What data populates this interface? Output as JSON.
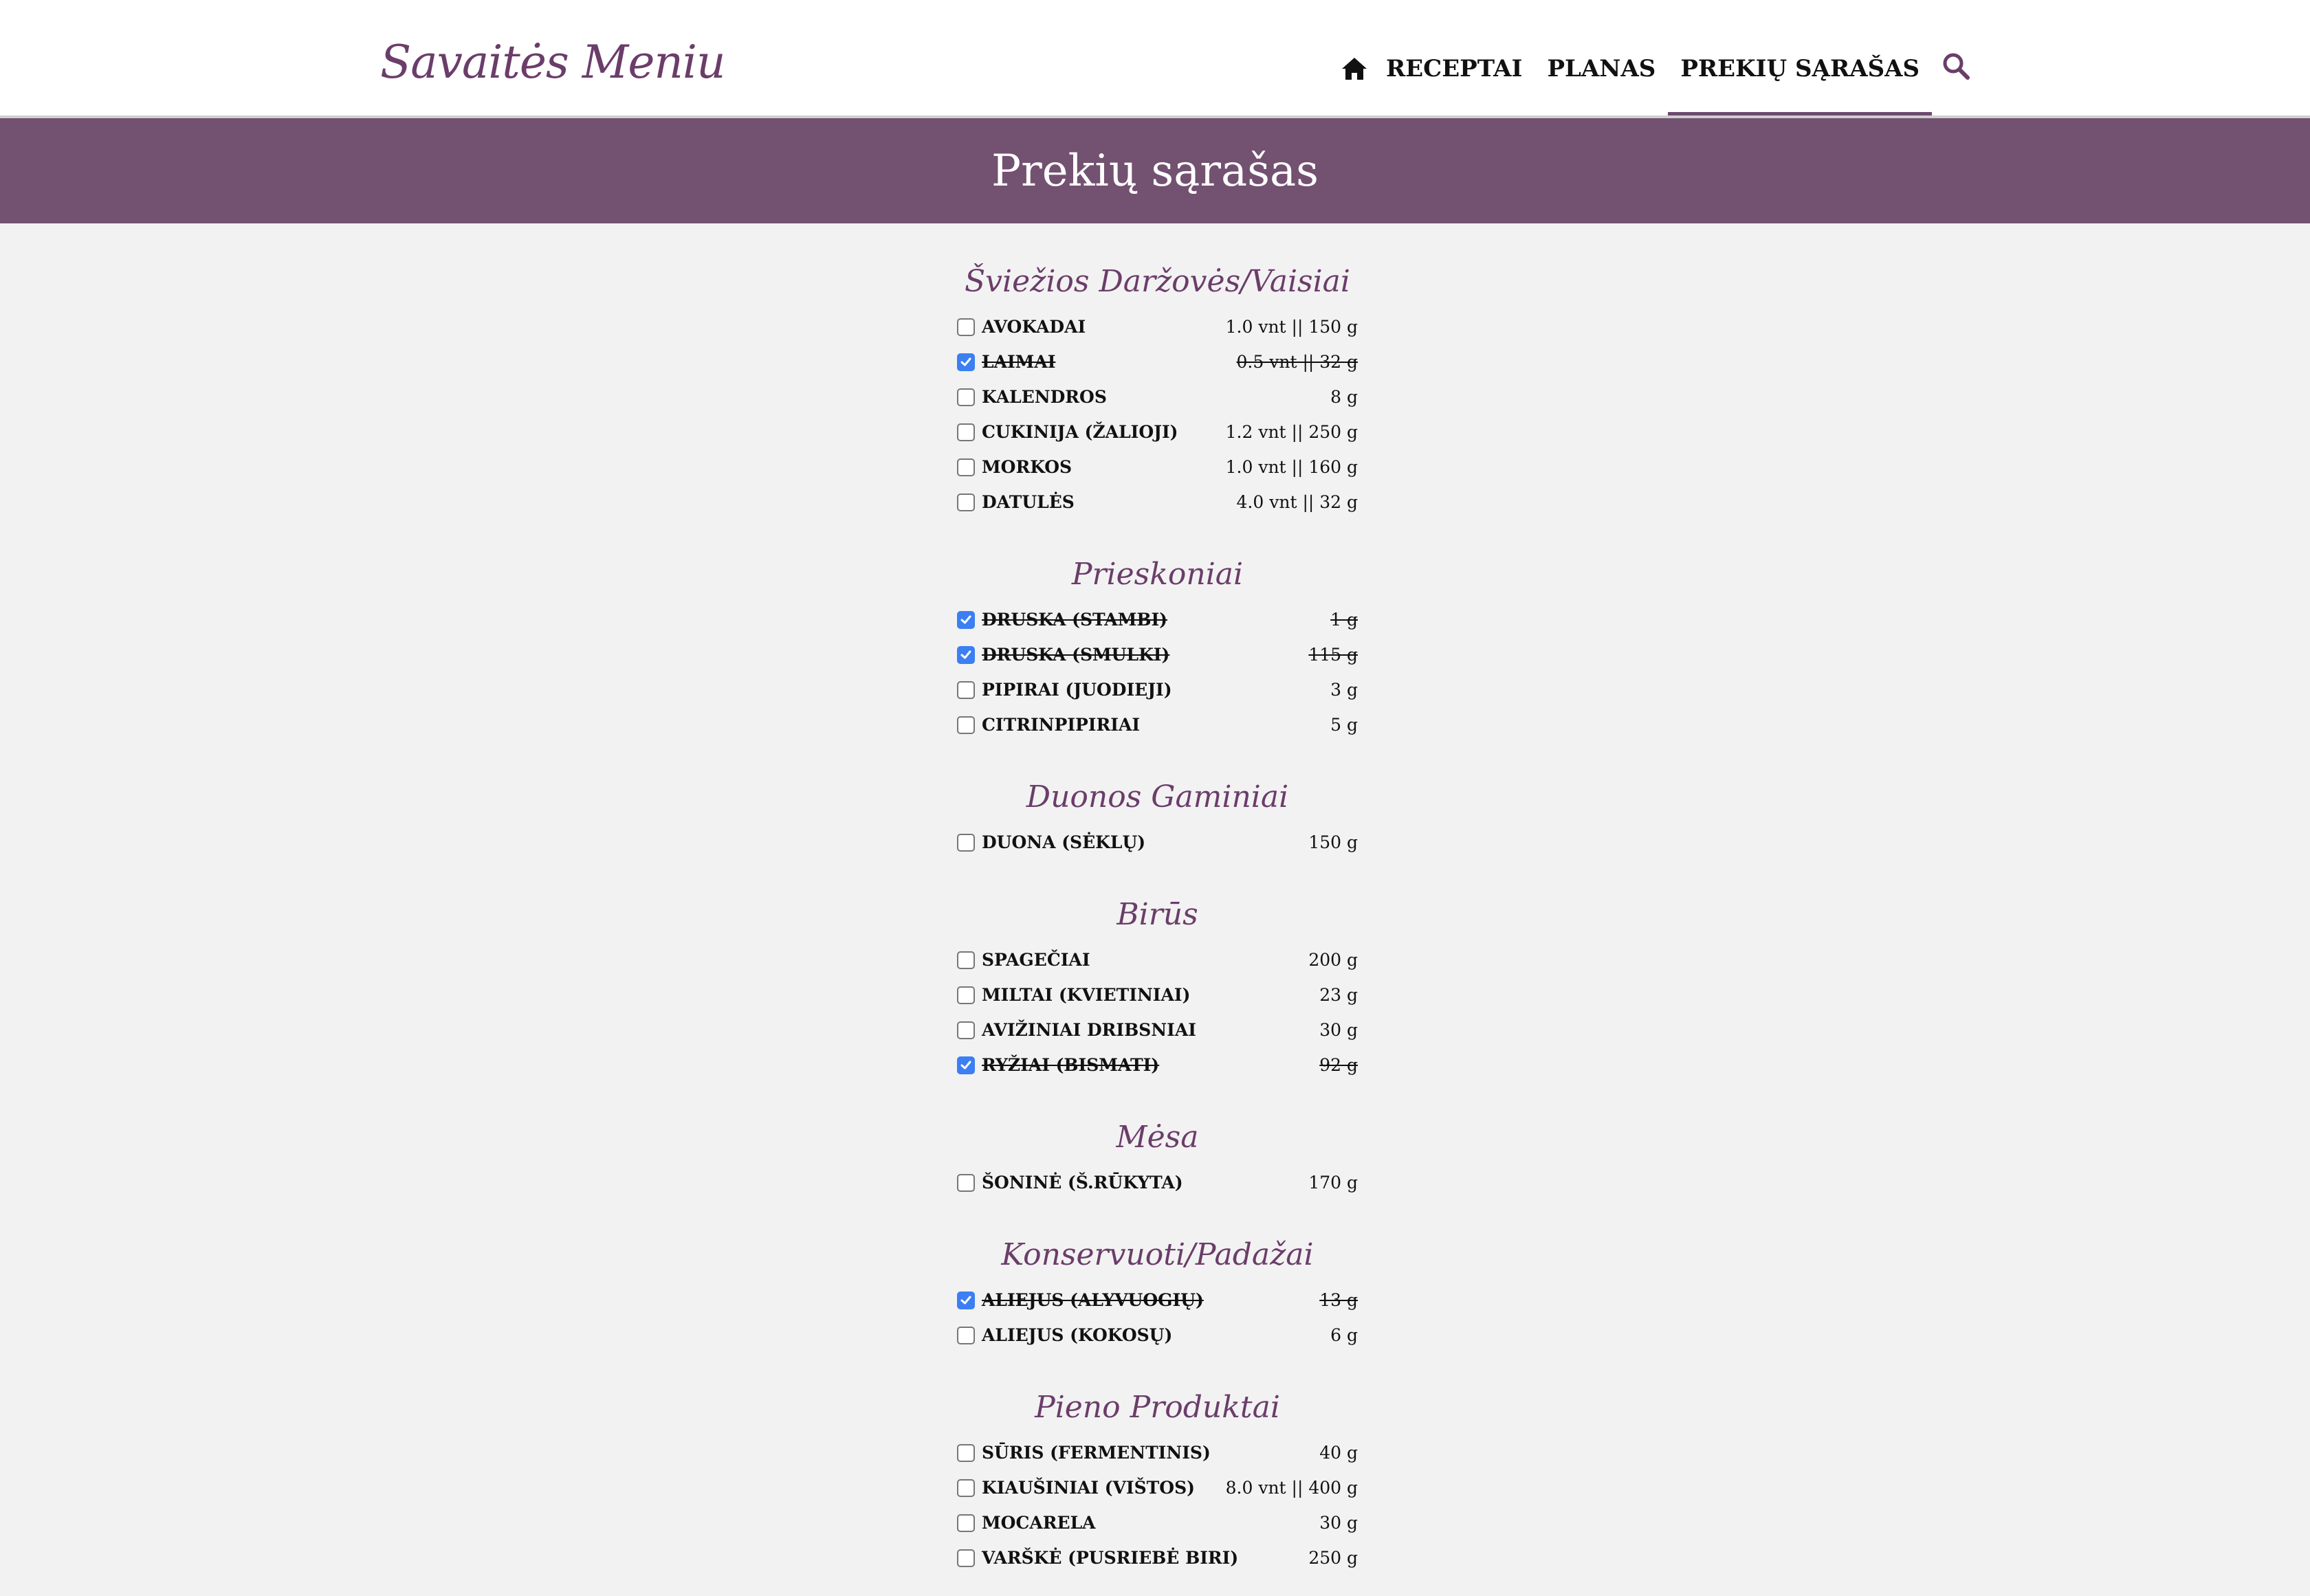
{
  "header": {
    "logo": "Savaitės Meniu",
    "nav": [
      {
        "label": "RECEPTAI",
        "active": false
      },
      {
        "label": "PLANAS",
        "active": false
      },
      {
        "label": "PREKIŲ SĄRAŠAS",
        "active": true
      }
    ],
    "icons": [
      "home-icon",
      "search-icon"
    ]
  },
  "page_title": "Prekių sąrašas",
  "colors": {
    "accent": "#735170",
    "heading": "#6b3d6a",
    "checkbox": "#3b7ff2"
  },
  "sections": [
    {
      "title": "Šviežios Daržovės/Vaisiai",
      "items": [
        {
          "name": "AVOKADAI",
          "qty": "1.0 vnt || 150 g",
          "checked": false
        },
        {
          "name": "LAIMAI",
          "qty": "0.5 vnt || 32 g",
          "checked": true
        },
        {
          "name": "KALENDROS",
          "qty": "8 g",
          "checked": false
        },
        {
          "name": "CUKINIJA (ŽALIOJI)",
          "qty": "1.2 vnt || 250 g",
          "checked": false
        },
        {
          "name": "MORKOS",
          "qty": "1.0 vnt || 160 g",
          "checked": false
        },
        {
          "name": "DATULĖS",
          "qty": "4.0 vnt || 32 g",
          "checked": false
        }
      ]
    },
    {
      "title": "Prieskoniai",
      "items": [
        {
          "name": "DRUSKA (STAMBI)",
          "qty": "1 g",
          "checked": true
        },
        {
          "name": "DRUSKA (SMULKI)",
          "qty": "115 g",
          "checked": true
        },
        {
          "name": "PIPIRAI (JUODIEJI)",
          "qty": "3 g",
          "checked": false
        },
        {
          "name": "CITRINPIPIRIAI",
          "qty": "5 g",
          "checked": false
        }
      ]
    },
    {
      "title": "Duonos Gaminiai",
      "items": [
        {
          "name": "DUONA (SĖKLŲ)",
          "qty": "150 g",
          "checked": false
        }
      ]
    },
    {
      "title": "Birūs",
      "items": [
        {
          "name": "SPAGEČIAI",
          "qty": "200 g",
          "checked": false
        },
        {
          "name": "MILTAI (KVIETINIAI)",
          "qty": "23 g",
          "checked": false
        },
        {
          "name": "AVIŽINIAI DRIBSNIAI",
          "qty": "30 g",
          "checked": false
        },
        {
          "name": "RYŽIAI (BISMATI)",
          "qty": "92 g",
          "checked": true
        }
      ]
    },
    {
      "title": "Mėsa",
      "items": [
        {
          "name": "ŠONINĖ (Š.RŪKYTA)",
          "qty": "170 g",
          "checked": false
        }
      ]
    },
    {
      "title": "Konservuoti/Padažai",
      "items": [
        {
          "name": "ALIEJUS (ALYVUOGIŲ)",
          "qty": "13 g",
          "checked": true
        },
        {
          "name": "ALIEJUS (KOKOSŲ)",
          "qty": "6 g",
          "checked": false
        }
      ]
    },
    {
      "title": "Pieno Produktai",
      "items": [
        {
          "name": "SŪRIS (FERMENTINIS)",
          "qty": "40 g",
          "checked": false
        },
        {
          "name": "KIAUŠINIAI (VIŠTOS)",
          "qty": "8.0 vnt || 400 g",
          "checked": false
        },
        {
          "name": "MOCARELA",
          "qty": "30 g",
          "checked": false
        },
        {
          "name": "VARŠKĖ (PUSRIEBĖ BIRI)",
          "qty": "250 g",
          "checked": false
        }
      ]
    }
  ]
}
